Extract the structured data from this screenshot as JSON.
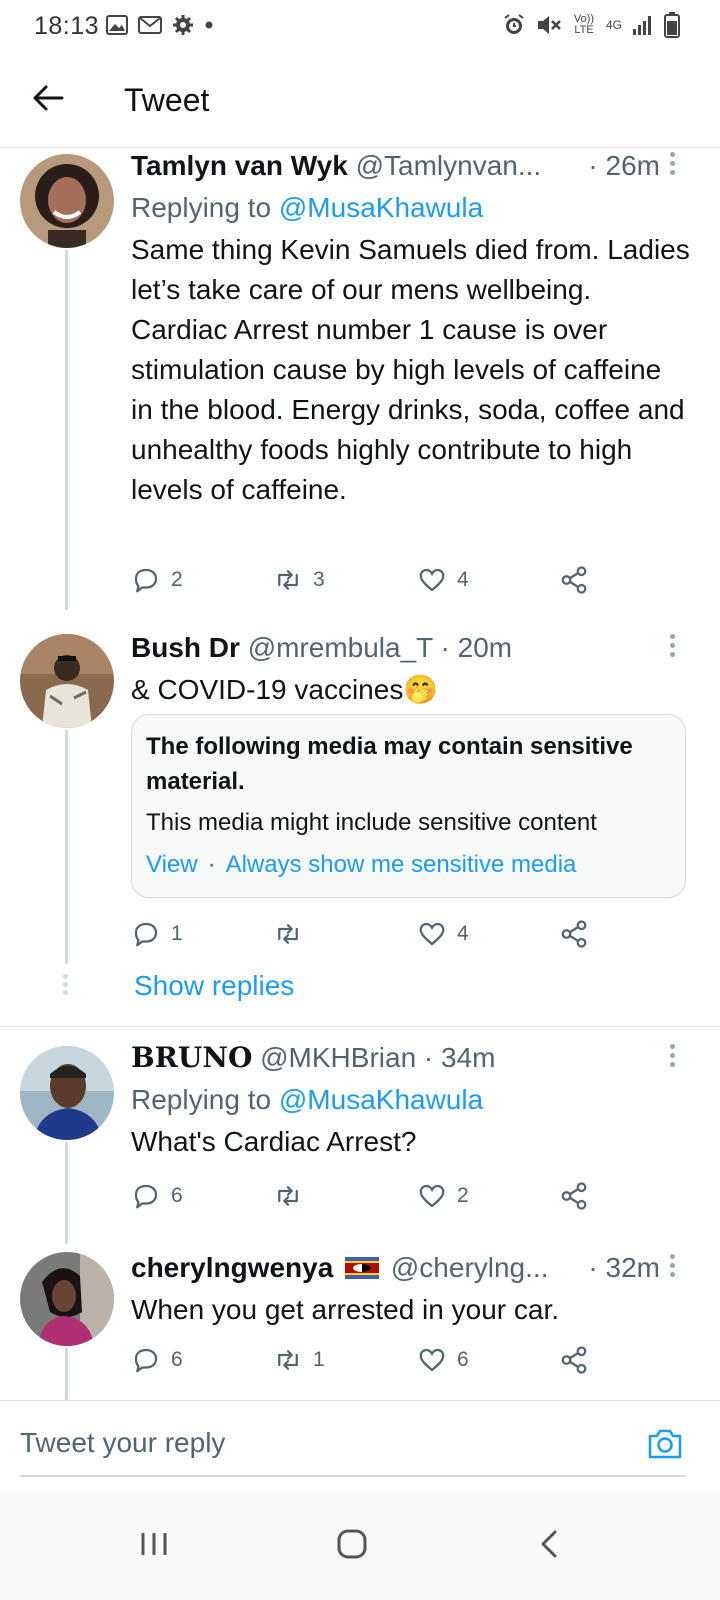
{
  "status_bar": {
    "time": "18:13",
    "left_icons": [
      "image-icon",
      "gmail-icon",
      "gear-icon",
      "dot-icon"
    ],
    "right_icons": [
      "alarm-icon",
      "mute-icon",
      "volte-icon",
      "4g-icon",
      "signal-icon",
      "battery-icon"
    ],
    "volte_label": "Vo)) LTE",
    "network_label": "4G"
  },
  "header": {
    "title": "Tweet"
  },
  "tweets": [
    {
      "name": "Tamlyn van Wyk",
      "handle": "@Tamlynvan...",
      "time": "· 26m",
      "replying_prefix": "Replying to ",
      "replying_to": "@MusaKhawula",
      "text": "Same thing Kevin Samuels died from. Ladies let’s take care of our mens wellbeing. Cardiac Arrest number 1 cause is over stimulation cause by high levels of caffeine in the blood. Energy drinks, soda, coffee and unhealthy foods highly contribute to high levels of caffeine.",
      "replies": "2",
      "retweets": "3",
      "likes": "4"
    },
    {
      "name": "Bush Dr",
      "handle": "@mrembula_T",
      "time": "· 20m",
      "text": "& COVID-19 vaccines🤭",
      "sensitive": {
        "title": "The following media may contain sensitive material.",
        "description": "This media might include sensitive content",
        "view_label": "View",
        "dot": "·",
        "always_label": "Always show me sensitive media"
      },
      "replies": "1",
      "retweets": "",
      "likes": "4",
      "show_replies": "Show replies"
    },
    {
      "name": "BRUNO",
      "handle": "@MKHBrian",
      "time": "· 34m",
      "replying_prefix": "Replying to ",
      "replying_to": "@MusaKhawula",
      "text": "What's Cardiac Arrest?",
      "replies": "6",
      "retweets": "",
      "likes": "2"
    },
    {
      "name": "cherylngwenya",
      "handle": "@cherylng...",
      "time": "· 32m",
      "text": "When you get arrested in your car.",
      "replies": "6",
      "retweets": "1",
      "likes": "6"
    }
  ],
  "reply_bar": {
    "placeholder": "Tweet your reply"
  },
  "nav": {
    "icons": [
      "recent-apps-icon",
      "home-icon",
      "back-icon"
    ]
  },
  "colors": {
    "link": "#1d9bf0",
    "secondary_text": "#536471",
    "thread_line": "#cfd9de"
  }
}
